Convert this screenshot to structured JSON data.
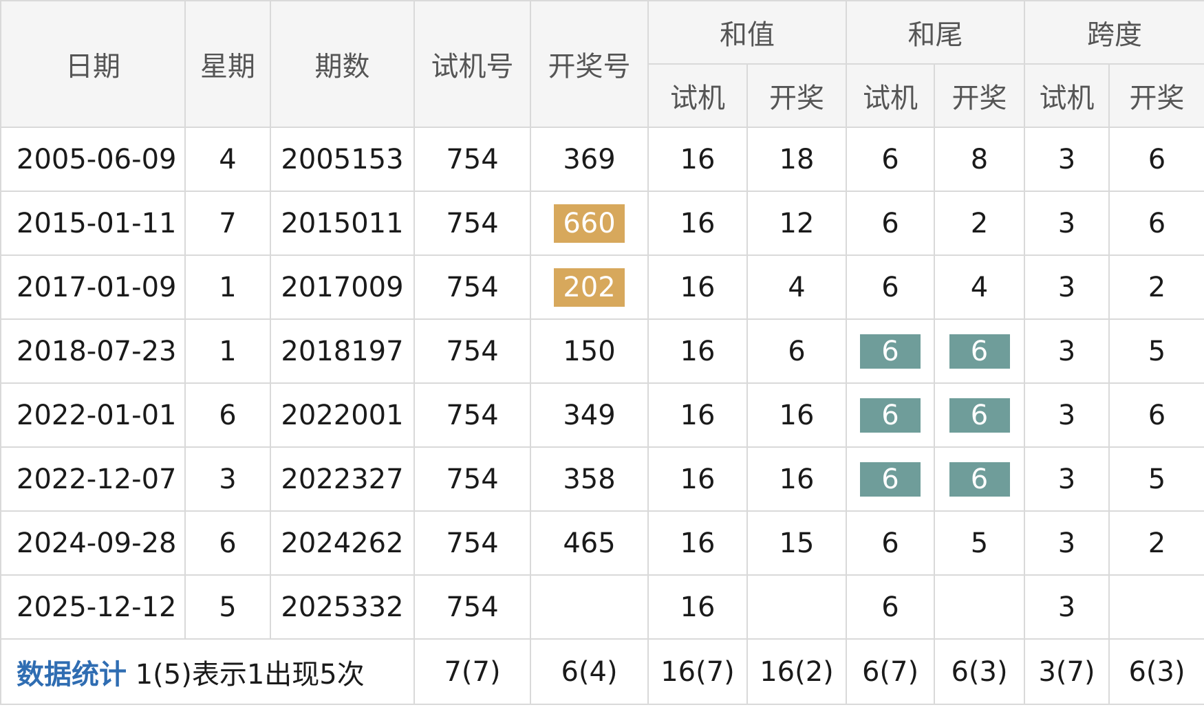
{
  "headers": {
    "date": "日期",
    "weekday": "星期",
    "issue": "期数",
    "trial": "试机号",
    "draw": "开奖号",
    "sum_group": "和值",
    "tail_group": "和尾",
    "span_group": "跨度",
    "trial_sub": "试机",
    "draw_sub": "开奖"
  },
  "rows": [
    {
      "date": "2005-06-09",
      "weekday": "4",
      "issue": "2005153",
      "trial": "754",
      "draw": "369",
      "sum_trial": "16",
      "sum_draw": "18",
      "tail_trial": "6",
      "tail_draw": "8",
      "span_trial": "3",
      "span_draw": "6"
    },
    {
      "date": "2015-01-11",
      "weekday": "7",
      "issue": "2015011",
      "trial": "754",
      "draw": "660",
      "sum_trial": "16",
      "sum_draw": "12",
      "tail_trial": "6",
      "tail_draw": "2",
      "span_trial": "3",
      "span_draw": "6"
    },
    {
      "date": "2017-01-09",
      "weekday": "1",
      "issue": "2017009",
      "trial": "754",
      "draw": "202",
      "sum_trial": "16",
      "sum_draw": "4",
      "tail_trial": "6",
      "tail_draw": "4",
      "span_trial": "3",
      "span_draw": "2"
    },
    {
      "date": "2018-07-23",
      "weekday": "1",
      "issue": "2018197",
      "trial": "754",
      "draw": "150",
      "sum_trial": "16",
      "sum_draw": "6",
      "tail_trial": "6",
      "tail_draw": "6",
      "span_trial": "3",
      "span_draw": "5"
    },
    {
      "date": "2022-01-01",
      "weekday": "6",
      "issue": "2022001",
      "trial": "754",
      "draw": "349",
      "sum_trial": "16",
      "sum_draw": "16",
      "tail_trial": "6",
      "tail_draw": "6",
      "span_trial": "3",
      "span_draw": "6"
    },
    {
      "date": "2022-12-07",
      "weekday": "3",
      "issue": "2022327",
      "trial": "754",
      "draw": "358",
      "sum_trial": "16",
      "sum_draw": "16",
      "tail_trial": "6",
      "tail_draw": "6",
      "span_trial": "3",
      "span_draw": "5"
    },
    {
      "date": "2024-09-28",
      "weekday": "6",
      "issue": "2024262",
      "trial": "754",
      "draw": "465",
      "sum_trial": "16",
      "sum_draw": "15",
      "tail_trial": "6",
      "tail_draw": "5",
      "span_trial": "3",
      "span_draw": "2"
    },
    {
      "date": "2025-12-12",
      "weekday": "5",
      "issue": "2025332",
      "trial": "754",
      "draw": "",
      "sum_trial": "16",
      "sum_draw": "",
      "tail_trial": "6",
      "tail_draw": "",
      "span_trial": "3",
      "span_draw": ""
    }
  ],
  "stats": {
    "title": "数据统计",
    "legend": "1(5)表示1出现5次",
    "trial": "7(7)",
    "draw": "6(4)",
    "sum_trial": "16(7)",
    "sum_draw": "16(2)",
    "tail_trial": "6(7)",
    "tail_draw": "6(3)",
    "span_trial": "3(7)",
    "span_draw": "6(3)"
  },
  "colors": {
    "header_bg": "#f5f5f5",
    "grid": "#d9d9d9",
    "red_text": "#c0282d",
    "gold_badge": "#d7a85c",
    "teal_badge": "#6f9d9a",
    "stat_blue": "#3f7bbf"
  }
}
